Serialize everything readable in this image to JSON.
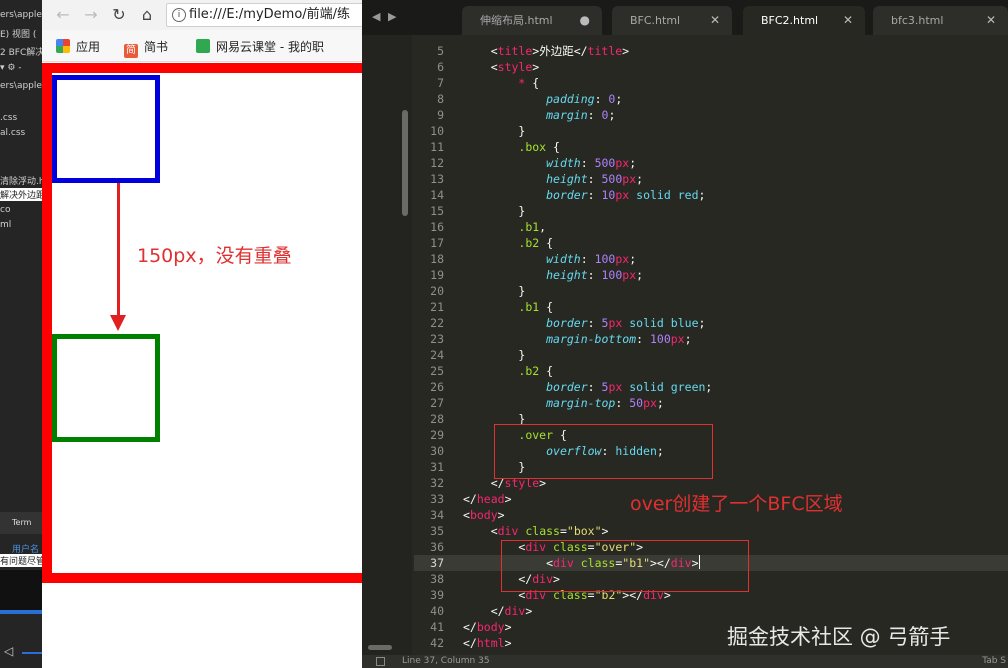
{
  "ide": {
    "lines": [
      "ers\\apple",
      "E) 视图 (",
      "2 BFC解决",
      "▾ ⚙ -",
      "ers\\apple\\",
      ".css",
      "al.css",
      "",
      "清除浮动.htm",
      "解决外边距合",
      "co",
      "ml"
    ],
    "terminal_label": "Term",
    "bottom_lines": [
      "用户名",
      "有问题尽管"
    ]
  },
  "browser": {
    "address": "file:///E:/myDemo/前端/练",
    "bookmarks": [
      {
        "label": "应用",
        "icon": "apps-icon"
      },
      {
        "label": "简书",
        "icon": "jianshu-icon"
      },
      {
        "label": "网易云课堂 - 我的职",
        "icon": "netease-icon"
      }
    ],
    "annotation": "150px，没有重叠"
  },
  "editor": {
    "tabs": [
      {
        "label": "伸缩布局.html",
        "close": "●",
        "active": false
      },
      {
        "label": "BFC.html",
        "close": "✕",
        "active": false
      },
      {
        "label": "BFC2.html",
        "close": "✕",
        "active": true
      },
      {
        "label": "bfc3.html",
        "close": "✕",
        "active": false
      }
    ],
    "line_numbers": [
      "5",
      "6",
      "7",
      "8",
      "9",
      "10",
      "11",
      "12",
      "13",
      "14",
      "15",
      "16",
      "17",
      "18",
      "19",
      "20",
      "21",
      "22",
      "23",
      "24",
      "25",
      "26",
      "27",
      "28",
      "29",
      "30",
      "31",
      "32",
      "33",
      "34",
      "35",
      "36",
      "37",
      "38",
      "39",
      "40",
      "41",
      "42"
    ],
    "annotation": "over创建了一个BFC区域",
    "watermark": "掘金技术社区 @ 弓箭手",
    "status": "Line 37, Column 35",
    "tab_size": "Tab S"
  },
  "colors": {
    "box_border": "#ff0000",
    "b1_border": "#0000dd",
    "b2_border": "#008000",
    "annotation": "#e03030",
    "editor_bg": "#272822"
  }
}
